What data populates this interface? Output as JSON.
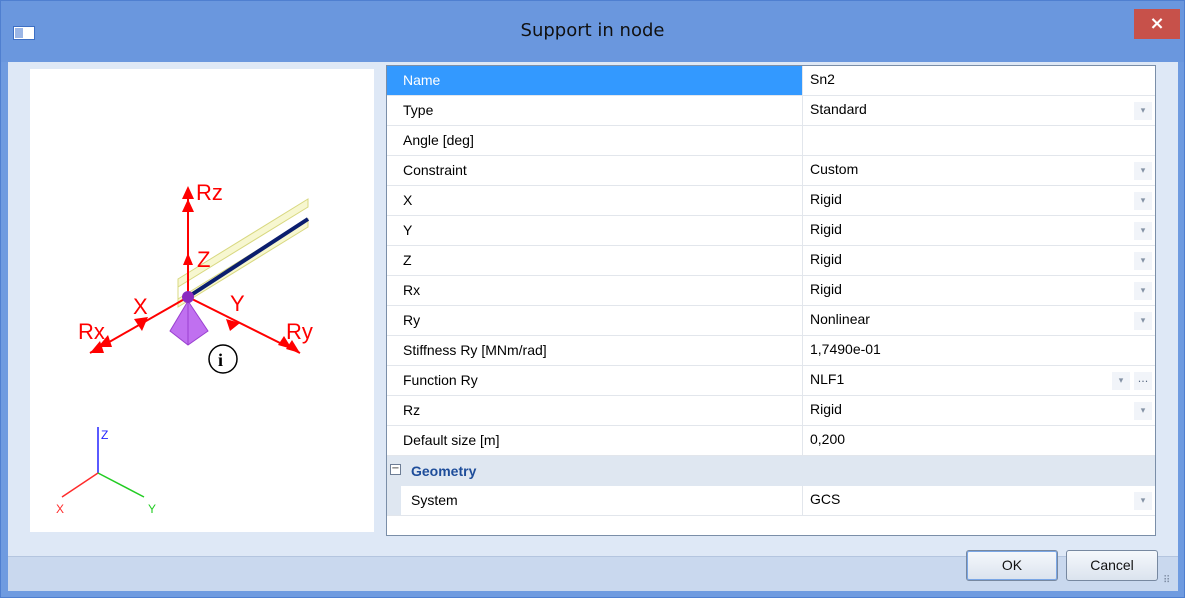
{
  "window": {
    "title": "Support in node",
    "close_glyph": "×"
  },
  "preview": {
    "labels": {
      "rz": "Rz",
      "z": "Z",
      "x": "X",
      "y": "Y",
      "rx": "Rx",
      "ry": "Ry",
      "info": "i"
    },
    "axes": {
      "z": "Z",
      "x": "X",
      "y": "Y"
    },
    "colors": {
      "arrows": "#ff0000",
      "support": "#c070f0",
      "beam": "#e8e8a0",
      "member": "#0b1e6e",
      "axis_x": "#ff2a2a",
      "axis_y": "#22cc22",
      "axis_z": "#2222ff"
    }
  },
  "properties": {
    "rows": [
      {
        "name": "Name",
        "value": "Sn2",
        "dropdown": false,
        "ellipsis": false
      },
      {
        "name": "Type",
        "value": "Standard",
        "dropdown": true,
        "ellipsis": false
      },
      {
        "name": "Angle [deg]",
        "value": "",
        "dropdown": false,
        "ellipsis": false
      },
      {
        "name": "Constraint",
        "value": "Custom",
        "dropdown": true,
        "ellipsis": false
      },
      {
        "name": "X",
        "value": "Rigid",
        "dropdown": true,
        "ellipsis": false
      },
      {
        "name": "Y",
        "value": "Rigid",
        "dropdown": true,
        "ellipsis": false
      },
      {
        "name": "Z",
        "value": "Rigid",
        "dropdown": true,
        "ellipsis": false
      },
      {
        "name": "Rx",
        "value": "Rigid",
        "dropdown": true,
        "ellipsis": false
      },
      {
        "name": "Ry",
        "value": "Nonlinear",
        "dropdown": true,
        "ellipsis": false
      },
      {
        "name": "Stiffness Ry [MNm/rad]",
        "value": "1,7490e-01",
        "dropdown": false,
        "ellipsis": false
      },
      {
        "name": "Function Ry",
        "value": "NLF1",
        "dropdown": true,
        "ellipsis": true
      },
      {
        "name": "Rz",
        "value": "Rigid",
        "dropdown": true,
        "ellipsis": false
      },
      {
        "name": "Default size [m]",
        "value": "0,200",
        "dropdown": false,
        "ellipsis": false
      }
    ],
    "group": {
      "toggle": "−",
      "label": "Geometry",
      "rows": [
        {
          "name": "System",
          "value": "GCS",
          "dropdown": true
        }
      ]
    },
    "dropdown_glyph": "▾",
    "ellipsis_glyph": "..."
  },
  "buttons": {
    "ok": "OK",
    "cancel": "Cancel"
  },
  "resize_grip_glyph": "⠿"
}
